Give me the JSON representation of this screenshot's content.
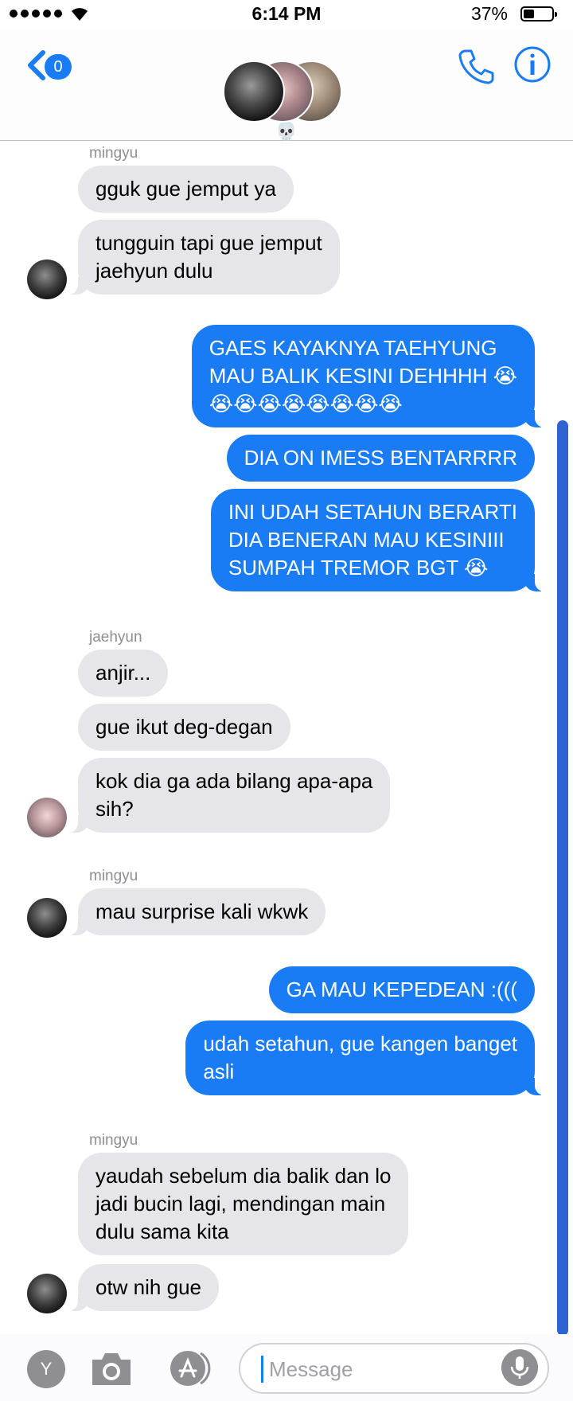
{
  "status_bar": {
    "time": "6:14 PM",
    "battery": "37%"
  },
  "header": {
    "back_count": "0",
    "group_emoji": "💀"
  },
  "messages": [
    {
      "sender": "mingyu",
      "lines": [
        "gguk gue jemput ya"
      ]
    },
    {
      "lines": [
        "tungguin tapi gue jemput",
        "jaehyun dulu"
      ]
    },
    {
      "lines": [
        "GAES KAYAKNYA TAEHYUNG",
        "MAU BALIK KESINI DEHHHH 😭",
        "😭😭😭😭😭😭😭😭"
      ]
    },
    {
      "lines": [
        "DIA ON IMESS BENTARRRR"
      ]
    },
    {
      "lines": [
        "INI UDAH SETAHUN BERARTI",
        "DIA BENERAN MAU KESINIII",
        "SUMPAH TREMOR BGT 😭"
      ]
    },
    {
      "sender": "jaehyun",
      "lines": [
        "anjir..."
      ]
    },
    {
      "lines": [
        "gue ikut deg-degan"
      ]
    },
    {
      "lines": [
        "kok dia ga ada bilang apa-apa",
        "sih?"
      ]
    },
    {
      "sender": "mingyu",
      "lines": [
        "mau surprise kali wkwk"
      ]
    },
    {
      "lines": [
        "GA MAU KEPEDEAN :((("
      ]
    },
    {
      "lines": [
        "udah setahun, gue kangen banget",
        "asli"
      ]
    },
    {
      "sender": "mingyu",
      "lines": [
        "yaudah sebelum dia balik dan lo",
        "jadi bucin lagi, mendingan main",
        "dulu sama kita"
      ]
    },
    {
      "lines": [
        "otw nih gue"
      ]
    }
  ],
  "input_bar": {
    "app_initial": "Y",
    "placeholder": "Message"
  },
  "colors": {
    "accent": "#1a7cf5",
    "incoming_bubble": "#e5e5ea",
    "scrollbar": "#2f63d2"
  },
  "icons": [
    "back-chevron-icon",
    "phone-icon",
    "info-icon",
    "camera-icon",
    "app-store-icon",
    "microphone-icon"
  ]
}
